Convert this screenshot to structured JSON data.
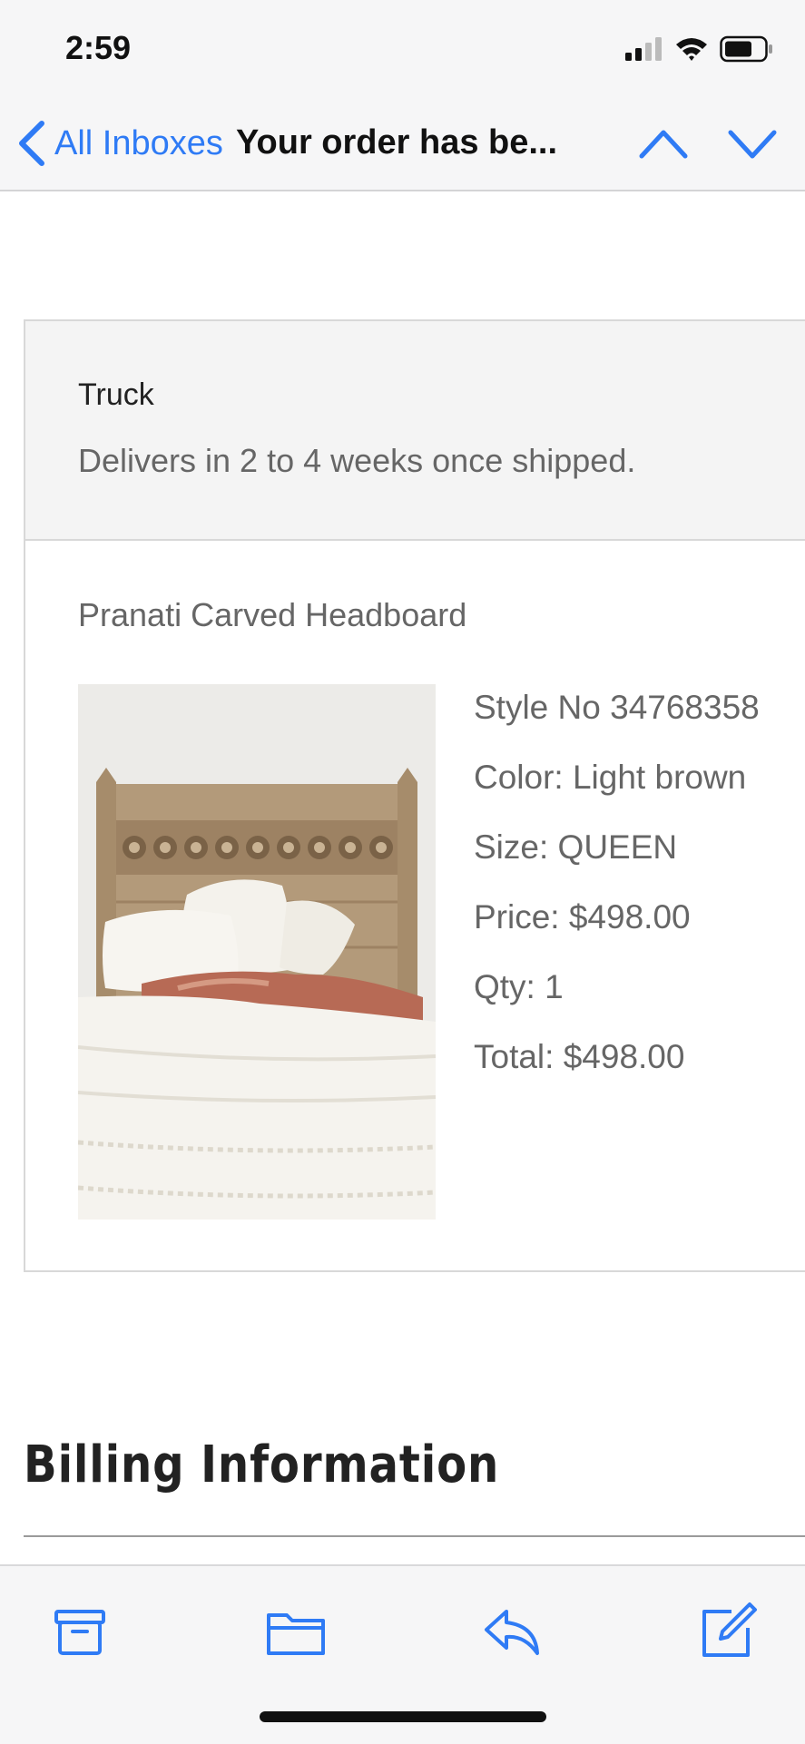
{
  "status_bar": {
    "time": "2:59",
    "icons": [
      "signal-icon",
      "wifi-icon",
      "battery-icon"
    ]
  },
  "nav": {
    "back_label": "All Inboxes",
    "title": "Your order has be...",
    "prev_icon": "chevron-up-icon",
    "next_icon": "chevron-down-icon"
  },
  "order": {
    "shipping_method": "Truck",
    "shipping_note": "Delivers in 2 to 4 weeks once shipped.",
    "product_name": "Pranati Carved Headboard",
    "details": [
      "Style No 34768358",
      "Color: Light brown",
      "Size: QUEEN",
      "Price: $498.00",
      "Qty: 1",
      "Total: $498.00"
    ]
  },
  "billing": {
    "heading": "Billing Information"
  },
  "toolbar": {
    "icons": [
      "archive-icon",
      "folder-icon",
      "reply-icon",
      "compose-icon"
    ]
  },
  "colors": {
    "accent": "#2f7bf5",
    "bar_bg": "#f6f6f7",
    "muted_text": "#666666"
  }
}
